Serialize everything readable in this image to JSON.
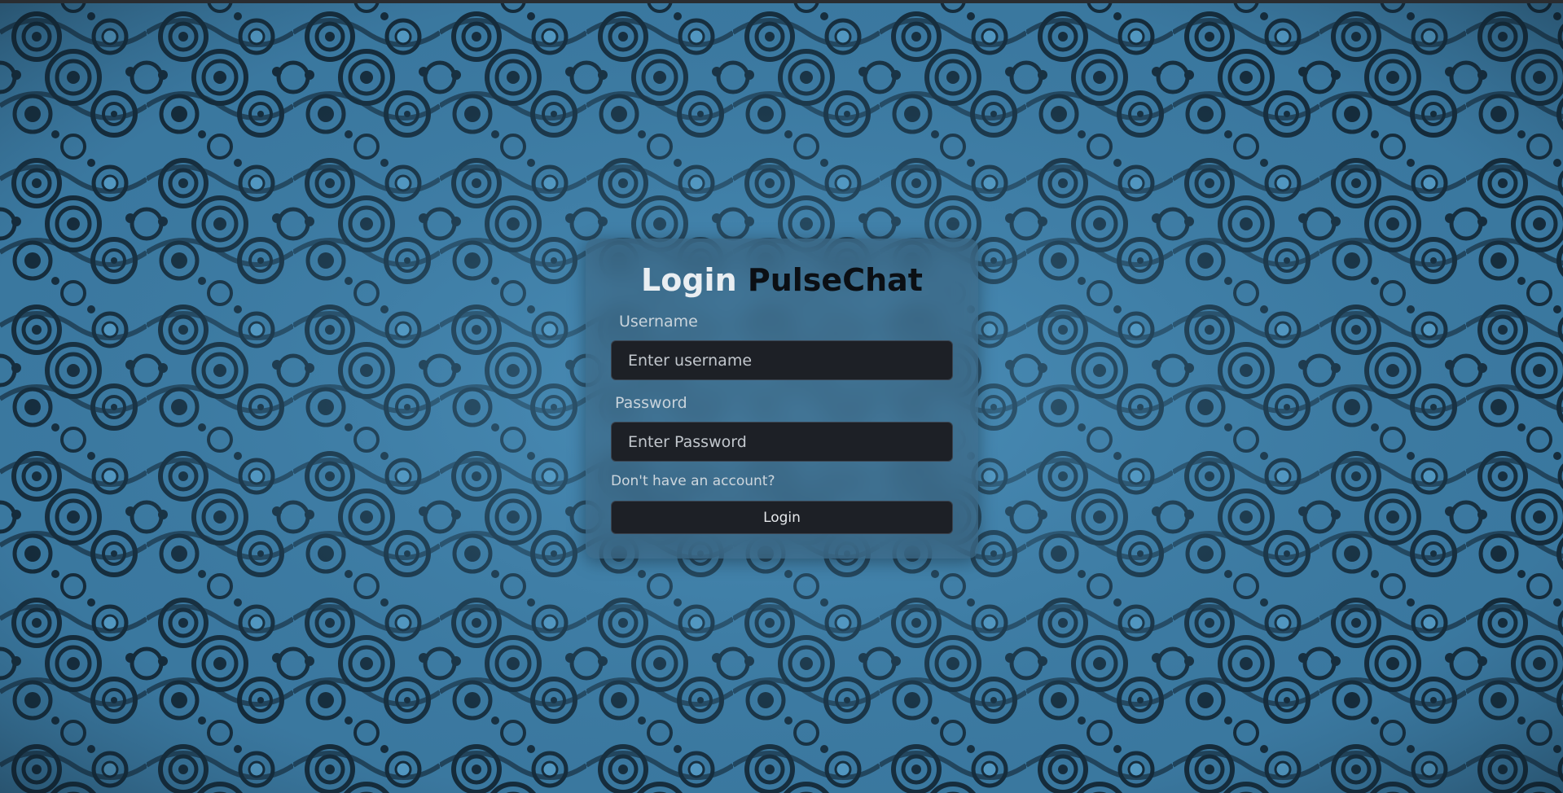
{
  "background": {
    "name": "blue-circular-pattern-background",
    "colors": {
      "base": "#3f7fa8",
      "light": "#5aa3cf",
      "dark": "#0c1a24"
    }
  },
  "login_card": {
    "title_part1": "Login",
    "title_part2": "PulseChat",
    "username_label": "Username",
    "username_placeholder": "Enter username",
    "password_label": "Password",
    "password_placeholder": "Enter Password",
    "signup_link": "Don't have an account?",
    "login_button": "Login"
  },
  "colors": {
    "input_bg": "#1d2026",
    "button_bg": "#1d2026",
    "title_light": "#e9eef2",
    "title_dark": "#0b0f14"
  }
}
